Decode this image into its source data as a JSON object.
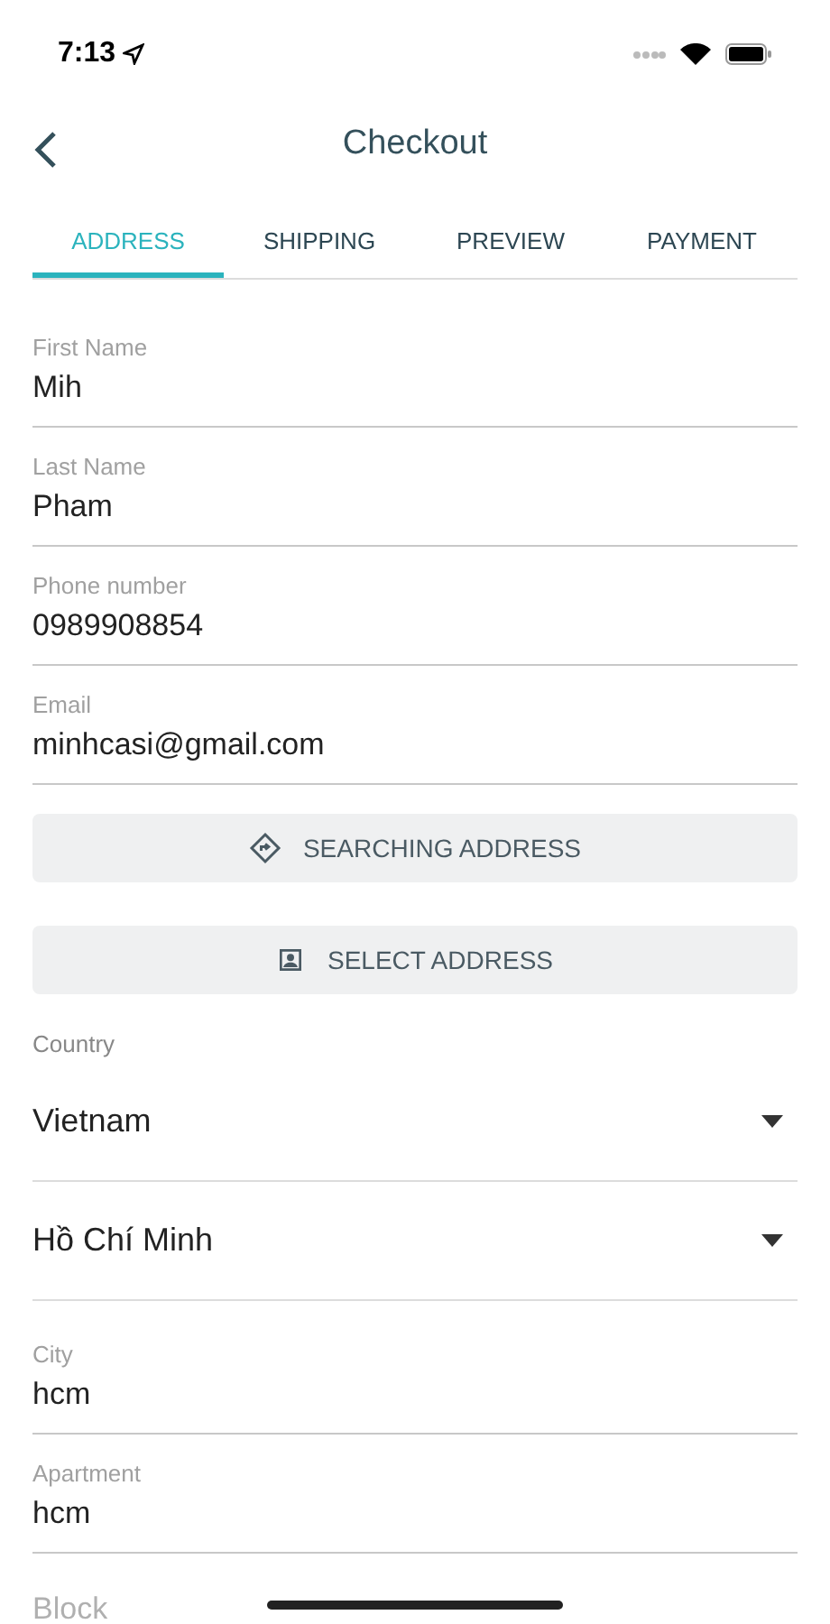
{
  "status_bar": {
    "time": "7:13"
  },
  "header": {
    "title": "Checkout"
  },
  "tabs": [
    {
      "label": "ADDRESS",
      "selected": true
    },
    {
      "label": "SHIPPING",
      "selected": false
    },
    {
      "label": "PREVIEW",
      "selected": false
    },
    {
      "label": "PAYMENT",
      "selected": false
    }
  ],
  "fields": [
    {
      "label": "First Name",
      "value": "Mih"
    },
    {
      "label": "Last Name",
      "value": "Pham"
    },
    {
      "label": "Phone number",
      "value": "0989908854"
    },
    {
      "label": "Email",
      "value": "minhcasi@gmail.com"
    }
  ],
  "buttons": [
    {
      "kind": "directions",
      "label": "SEARCHING ADDRESS"
    },
    {
      "kind": "contact",
      "label": "SELECT ADDRESS"
    }
  ],
  "country": {
    "label": "Country",
    "value": "Vietnam"
  },
  "state": {
    "value": "Hồ Chí Minh"
  },
  "address_fields": [
    {
      "label": "City",
      "value": "hcm"
    },
    {
      "label": "Apartment",
      "value": "hcm"
    }
  ],
  "block": {
    "placeholder": "Block"
  }
}
